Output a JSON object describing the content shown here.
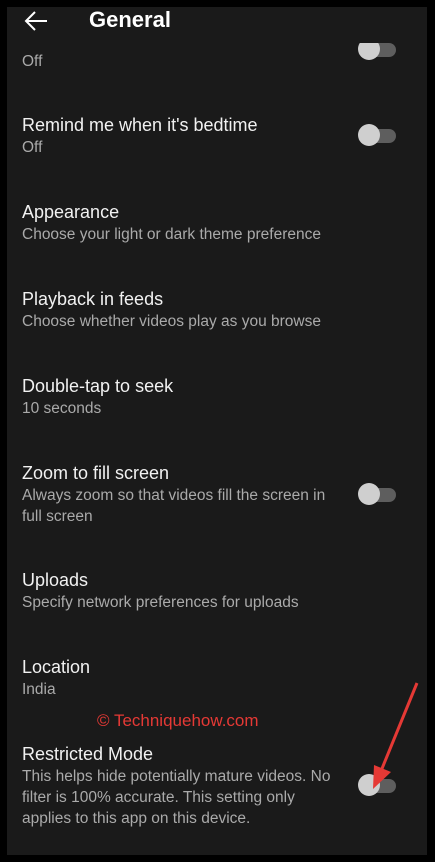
{
  "header": {
    "title": "General"
  },
  "settings": [
    {
      "title": "",
      "subtitle": "Off",
      "toggle": true,
      "on": false
    },
    {
      "title": "Remind me when it's bedtime",
      "subtitle": "Off",
      "toggle": true,
      "on": false
    },
    {
      "title": "Appearance",
      "subtitle": "Choose your light or dark theme preference",
      "toggle": false
    },
    {
      "title": "Playback in feeds",
      "subtitle": "Choose whether videos play as you browse",
      "toggle": false
    },
    {
      "title": "Double-tap to seek",
      "subtitle": "10 seconds",
      "toggle": false
    },
    {
      "title": "Zoom to fill screen",
      "subtitle": "Always zoom so that videos fill the screen in full screen",
      "toggle": true,
      "on": false
    },
    {
      "title": "Uploads",
      "subtitle": "Specify network preferences for uploads",
      "toggle": false
    },
    {
      "title": "Location",
      "subtitle": "India",
      "toggle": false
    },
    {
      "title": "Restricted Mode",
      "subtitle": "This helps hide potentially mature videos. No filter is 100% accurate. This setting only applies to this app on this device.",
      "toggle": true,
      "on": false
    }
  ],
  "watermark": "© Techniquehow.com",
  "colors": {
    "background": "#1a1a1a",
    "annotation": "#e53935"
  }
}
